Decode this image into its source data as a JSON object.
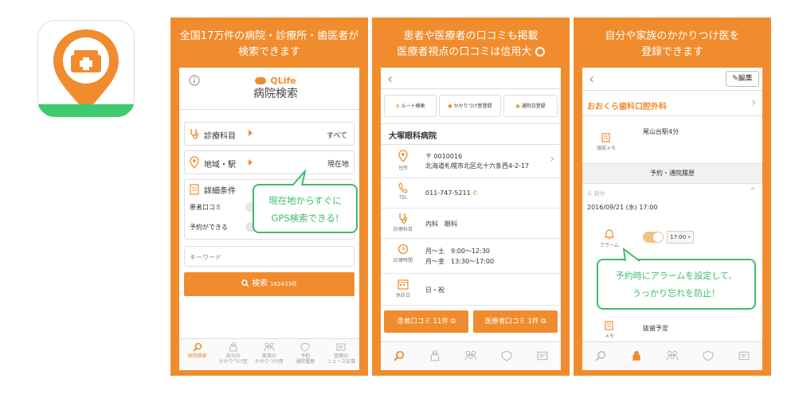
{
  "colors": {
    "accent": "#f08c2d",
    "bubble": "#3ebd6e",
    "green_bar": "#3ecb6e"
  },
  "icons": [
    "hospital-pin-icon",
    "search-icon",
    "person-icon",
    "family-icon",
    "shield-icon",
    "news-icon",
    "info-icon",
    "stethoscope-icon",
    "location-pin-icon",
    "edit-list-icon",
    "phone-icon",
    "clock-icon",
    "calendar-icon",
    "bell-icon",
    "memo-icon",
    "external-link-icon"
  ],
  "panel1": {
    "caption_line1": "全国17万件の病院・診療所・歯医者が",
    "caption_line2": "検索できます",
    "logo": "QLife",
    "title": "病院検索",
    "dept_label": "診療科目",
    "dept_value": "すべて",
    "area_label": "地域・駅",
    "area_value": "現在地",
    "detail_label": "詳細条件",
    "cond1": "患者口コミ",
    "cond2": "予約ができる",
    "keyword_placeholder": "キーワード",
    "search_label": "検索",
    "search_count": "162433件",
    "bubble_line1": "現在地からすぐに",
    "bubble_line2": "GPS検索できる!",
    "tabs": [
      "病院検索",
      "自分の\nかかりつけ医",
      "家族の\nかかりつけ医",
      "予約\n通院履歴",
      "医療の\nニュース記事"
    ]
  },
  "panel2": {
    "caption_line1": "患者や医療者の口コミも掲載",
    "caption_line2": "医療者視点の口コミは信用大",
    "btn_route": "ルート検索",
    "btn_kakari": "かかりつけ医登録",
    "btn_visit": "通院日登録",
    "clinic": "大塚眼科病院",
    "addr_label": "住所",
    "addr_zip": "〒 0010016",
    "addr_text": "北海道札幌市北区北十六条西4-2-17",
    "tel_label": "TEL",
    "tel_value": "011-747-5211",
    "dept_label": "診療科目",
    "dept_value": "内科　眼科",
    "hours_label": "診療時間",
    "hours1": "月〜土　9:00〜12:30",
    "hours2": "月〜金　13:30〜17:00",
    "holiday_label": "休診日",
    "holiday_value": "日・祝",
    "review_patient": "患者口コミ 11件",
    "review_medical": "医療者口コミ 1件"
  },
  "panel3": {
    "caption_line1": "自分や家族のかかりつけ医を",
    "caption_line2": "登録できます",
    "edit": "編集",
    "clinic": "おおくら歯科口腔外科",
    "station": "尾山台駅4分",
    "memo_label": "施設メモ",
    "section": "予約・通院履歴",
    "owner": "自分",
    "datetime": "2016/09/21 (水) 17:00",
    "alarm_label": "アラーム",
    "alarm_time": "17:00",
    "bubble_line1": "予約時にアラームを設定して、",
    "bubble_line2": "うっかり忘れを防止！",
    "memo2_label": "メモ",
    "memo2_value": "抜歯予定"
  }
}
